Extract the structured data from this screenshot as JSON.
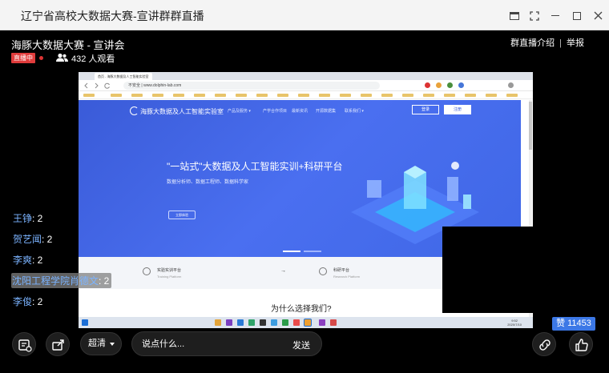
{
  "window": {
    "title": "辽宁省高校大数据大赛-宣讲群群直播"
  },
  "live": {
    "title": "海豚大数据大赛 - 宣讲会",
    "badge": "直播中",
    "viewers": "432 人观看",
    "links": [
      "群直播介绍",
      "举报"
    ],
    "link_separator": "|"
  },
  "video": {
    "browser_url": "不安全 | www.dolphin-lab.com",
    "tab_label": "首页 - 海豚大数据及人工智能实验室",
    "site_brand": "海豚大数据及人工智能实验室",
    "nav": [
      "产品及服务 ▾",
      "产学合作项目",
      "最新资讯",
      "开源数据集",
      "联系我们 ▾"
    ],
    "login": "登录",
    "register": "注册",
    "hero_title": "\"一站式\"大数据及人工智能实训+科研平台",
    "hero_subtitle": "数据分析师、数据工程师、数据科学家",
    "hero_button": "立即体验",
    "platforms": [
      {
        "name": "实验实训平台",
        "en": "Training Platform"
      },
      {
        "name": "科研平台",
        "en": "Research Platform"
      }
    ],
    "arrow": "→",
    "section_caption": "为什么选择我们?",
    "taskbar_time": "9:52",
    "taskbar_date": "2020/7/10"
  },
  "chat": [
    {
      "user": "王铮",
      "text": ": 2"
    },
    {
      "user": "贺艺闻",
      "text": ": 2"
    },
    {
      "user": "李爽",
      "text": ": 2"
    },
    {
      "user": "沈阳工程学院肖德文",
      "text": ": 2",
      "highlighted": true
    },
    {
      "user": "李俊",
      "text": ": 2"
    }
  ],
  "controls": {
    "quality": "超清",
    "input_placeholder": "说点什么...",
    "send": "发送",
    "like_count": "赞 11453"
  },
  "colors": {
    "accent_blue": "#3c78e6",
    "live_red": "#e03c3c",
    "chat_user": "#7bb3ff",
    "hero_blue": "#4a6ff0"
  }
}
